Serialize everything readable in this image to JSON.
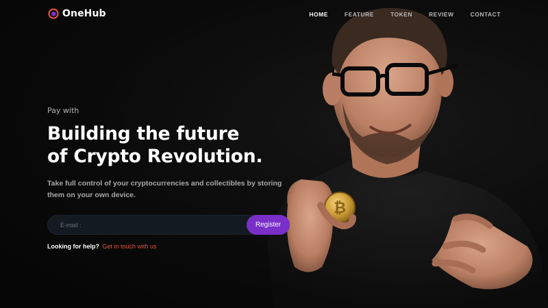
{
  "brand": {
    "name": "OneHub",
    "logo_icon": "ring-logo-icon",
    "logo_colors": [
      "#e0553f",
      "#7a2fc9"
    ]
  },
  "nav": {
    "items": [
      {
        "label": "HOME",
        "active": true
      },
      {
        "label": "FEATURE",
        "active": false
      },
      {
        "label": "TOKEN",
        "active": false
      },
      {
        "label": "REVIEW",
        "active": false
      },
      {
        "label": "CONTACT",
        "active": false
      }
    ]
  },
  "hero": {
    "eyebrow": "Pay with",
    "headline_line1": "Building the future",
    "headline_line2": "of Crypto Revolution.",
    "description": "Take full control of your cryptocurrencies and collectibles by storing them on your own device.",
    "email_placeholder": "E-mail :",
    "register_label": "Register",
    "help_text": "Looking for help?",
    "help_link": "Get in touch with us"
  },
  "colors": {
    "accent": "#7a2fc9",
    "link": "#e0553f",
    "background": "#080808"
  }
}
